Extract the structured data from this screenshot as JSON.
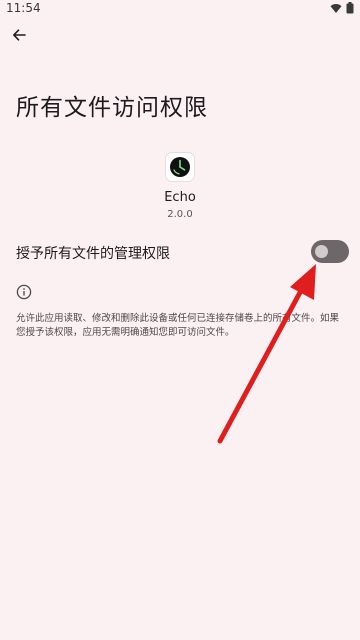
{
  "status_bar": {
    "time": "11:54",
    "icons": [
      "wifi-icon",
      "battery-icon"
    ]
  },
  "header": {
    "back_icon": "arrow-back-icon"
  },
  "page": {
    "title": "所有文件访问权限"
  },
  "app": {
    "name": "Echo",
    "version": "2.0.0"
  },
  "permission": {
    "label": "授予所有文件的管理权限",
    "enabled": false
  },
  "info": {
    "icon": "info-icon",
    "description": "允许此应用读取、修改和删除此设备或任何已连接存储卷上的所有文件。如果您授予该权限，应用无需明确通知您即可访问文件。"
  },
  "colors": {
    "background": "#FBF1F3",
    "toggle_track_off": "#6E676A",
    "toggle_thumb_off": "#D3CACE",
    "annotation_arrow": "#E01E1E"
  }
}
